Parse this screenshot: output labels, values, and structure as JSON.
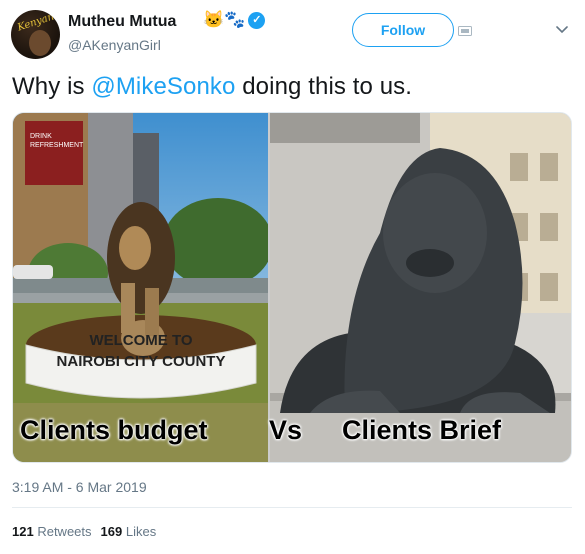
{
  "tweet": {
    "display_name": "Mutheu Mutua",
    "name_emoji": [
      "cat-face-emoji",
      "paw-prints-emoji"
    ],
    "handle": "@AKenyanGirl",
    "follow_label": "Follow",
    "text_before": "Why is ",
    "mention": "@MikeSonko",
    "text_after": " doing this to us.",
    "timestamp": "3:19 AM - 6 Mar 2019",
    "retweets_count": "121",
    "retweets_label": "Retweets",
    "likes_count": "169",
    "likes_label": "Likes"
  },
  "avatar": {
    "script_text": "Kenyan"
  },
  "media": {
    "left_sign_line1": "WELCOME TO",
    "left_sign_line2": "NAIROBI CITY COUNTY",
    "left_caption": "Clients budget",
    "vs_caption": "Vs",
    "right_caption": "Clients Brief",
    "billboard_line1": "DRINK",
    "billboard_line2": "REFRESHMENT"
  },
  "colors": {
    "accent": "#1da1f2",
    "text": "#14171a",
    "muted": "#657786"
  },
  "icons": [
    "verified-badge-icon",
    "device-icon",
    "chevron-down-icon"
  ]
}
